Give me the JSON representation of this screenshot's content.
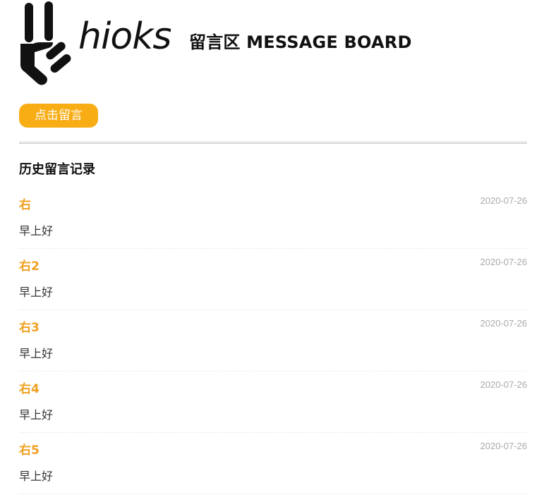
{
  "header": {
    "logo_text": "hioks",
    "board_title": "留言区 MESSAGE BOARD"
  },
  "post_button": {
    "label": "点击留言"
  },
  "history": {
    "title": "历史留言记录",
    "items": [
      {
        "name": "右",
        "date": "2020-07-26",
        "message": "早上好"
      },
      {
        "name": "右2",
        "date": "2020-07-26",
        "message": "早上好"
      },
      {
        "name": "右3",
        "date": "2020-07-26",
        "message": "早上好"
      },
      {
        "name": "右4",
        "date": "2020-07-26",
        "message": "早上好"
      },
      {
        "name": "右5",
        "date": "2020-07-26",
        "message": "早上好"
      }
    ]
  },
  "colors": {
    "accent": "#f8ad15",
    "name_text": "#f0a020",
    "date_text": "#aaaaaa"
  }
}
